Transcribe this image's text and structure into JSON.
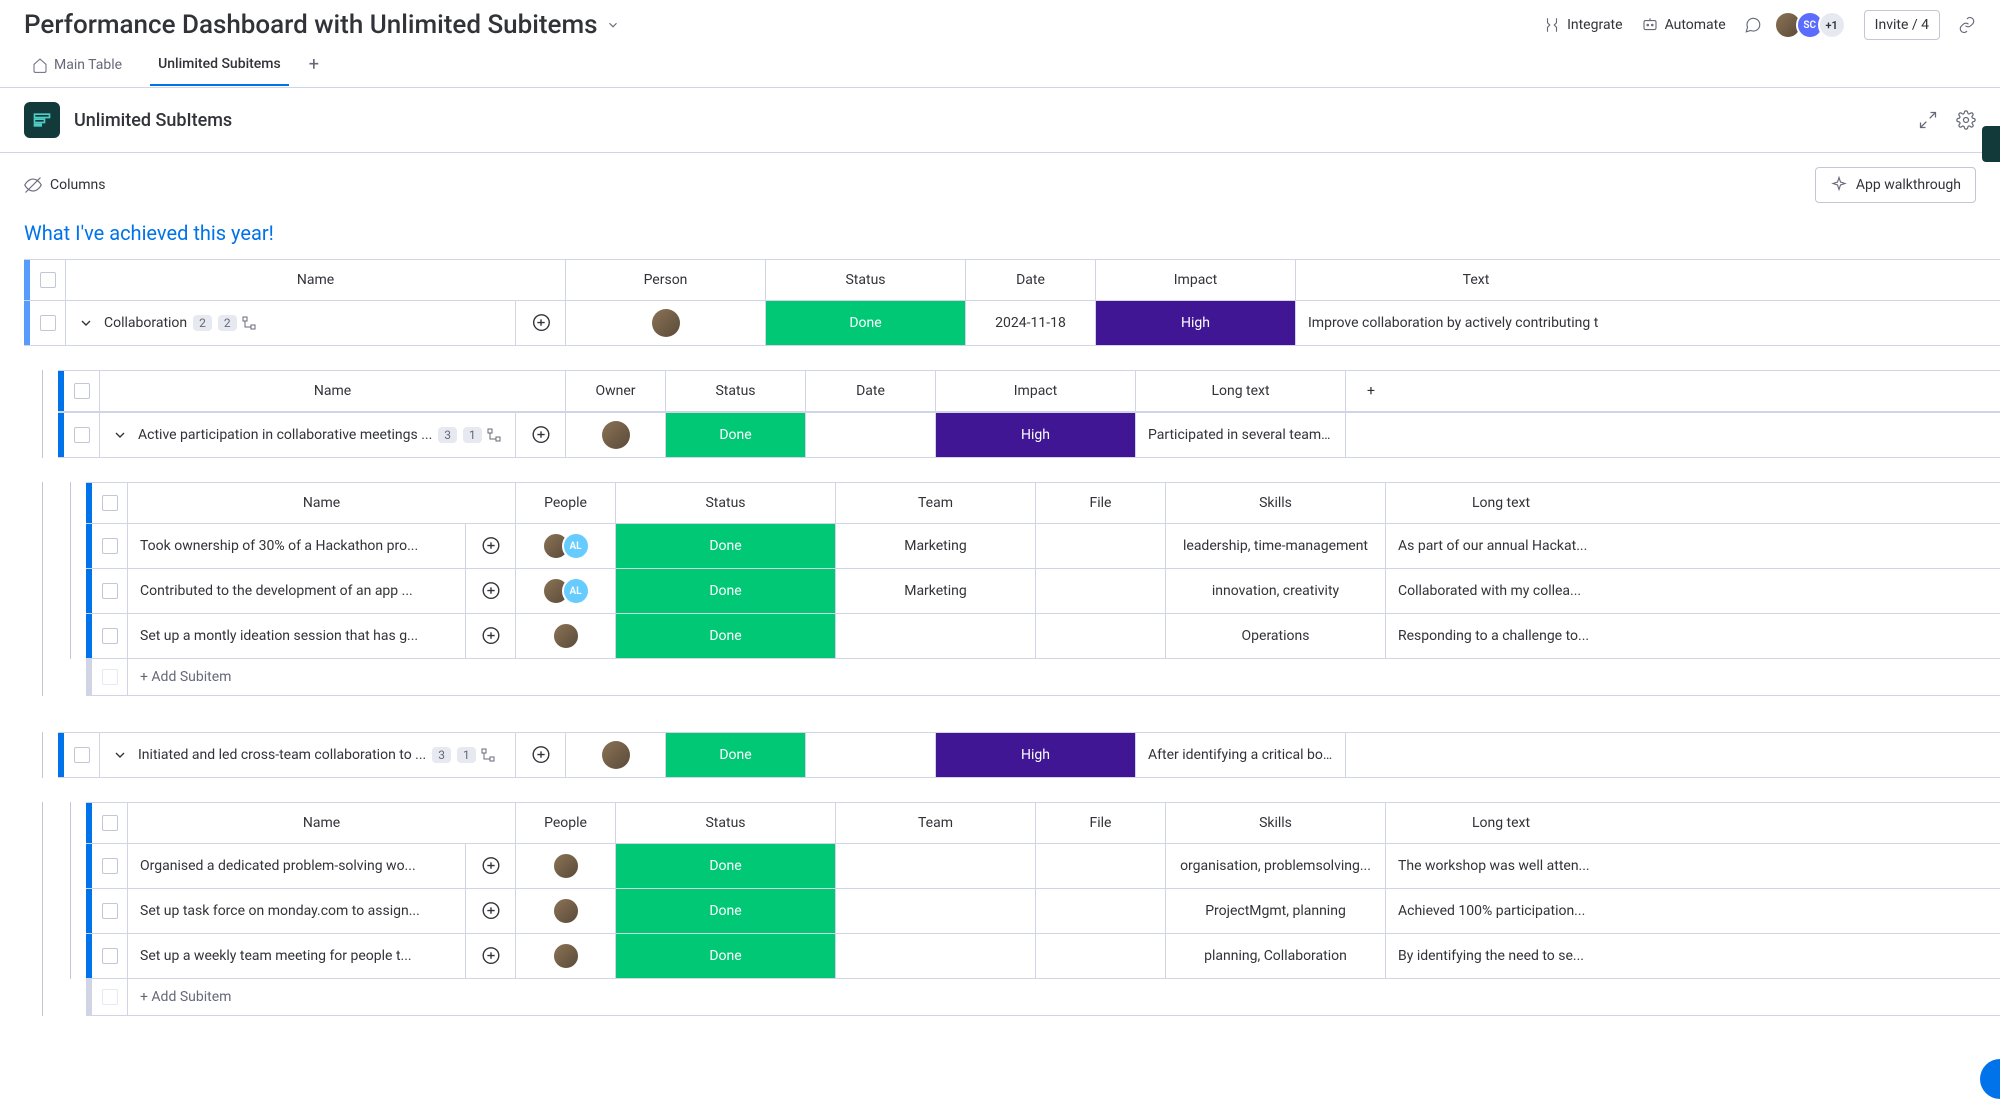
{
  "header": {
    "title": "Performance Dashboard with Unlimited Subitems",
    "integrate": "Integrate",
    "automate": "Automate",
    "invite": "Invite / 4",
    "avatar_plus": "+1",
    "avatar_sc": "SC"
  },
  "tabs": {
    "main": "Main Table",
    "subitems": "Unlimited Subitems"
  },
  "appbar": {
    "title": "Unlimited SubItems"
  },
  "subbar": {
    "columns": "Columns",
    "walkthrough": "App walkthrough"
  },
  "section_title": "What I've achieved this year!",
  "l0": {
    "headers": {
      "name": "Name",
      "person": "Person",
      "status": "Status",
      "date": "Date",
      "impact": "Impact",
      "text": "Text"
    },
    "row": {
      "name": "Collaboration",
      "count1": "2",
      "count2": "2",
      "status": "Done",
      "date": "2024-11-18",
      "impact": "High",
      "text": "Improve collaboration by actively contributing t"
    }
  },
  "l1": {
    "headers": {
      "name": "Name",
      "owner": "Owner",
      "status": "Status",
      "date": "Date",
      "impact": "Impact",
      "longtext": "Long text"
    },
    "rows": [
      {
        "name": "Active participation in collaborative meetings ...",
        "c1": "3",
        "c2": "1",
        "status": "Done",
        "impact": "High",
        "longtext": "Participated in several team ..."
      },
      {
        "name": "Initiated and led cross-team collaboration to ...",
        "c1": "3",
        "c2": "1",
        "status": "Done",
        "impact": "High",
        "longtext": "After identifying a critical bo..."
      }
    ]
  },
  "l2": {
    "headers": {
      "name": "Name",
      "people": "People",
      "status": "Status",
      "team": "Team",
      "file": "File",
      "skills": "Skills",
      "longtext": "Long text"
    },
    "groupA": [
      {
        "name": "Took ownership of 30% of a Hackathon pro...",
        "status": "Done",
        "team": "Marketing",
        "skills": "leadership, time-management",
        "longtext": "As part of our annual Hackat...",
        "al": true
      },
      {
        "name": "Contributed to the development of an app ...",
        "status": "Done",
        "team": "Marketing",
        "skills": "innovation, creativity",
        "longtext": "Collaborated with my collea...",
        "al": true
      },
      {
        "name": "Set up a montly ideation session that has g...",
        "status": "Done",
        "team": "",
        "skills": "Operations",
        "longtext": "Responding to a challenge to...",
        "al": false
      }
    ],
    "groupB": [
      {
        "name": "Organised a dedicated problem-solving wo...",
        "status": "Done",
        "team": "",
        "skills": "organisation, problemsolving...",
        "longtext": "The workshop was well atten...",
        "al": false
      },
      {
        "name": "Set up task force on monday.com to assign...",
        "status": "Done",
        "team": "",
        "skills": "ProjectMgmt, planning",
        "longtext": "Achieved 100% participation...",
        "al": false
      },
      {
        "name": "Set up a weekly team meeting for people t...",
        "status": "Done",
        "team": "",
        "skills": "planning, Collaboration",
        "longtext": "By identifying the need to se...",
        "al": false
      }
    ]
  },
  "add_subitem": "+ Add Subitem",
  "al_label": "AL"
}
